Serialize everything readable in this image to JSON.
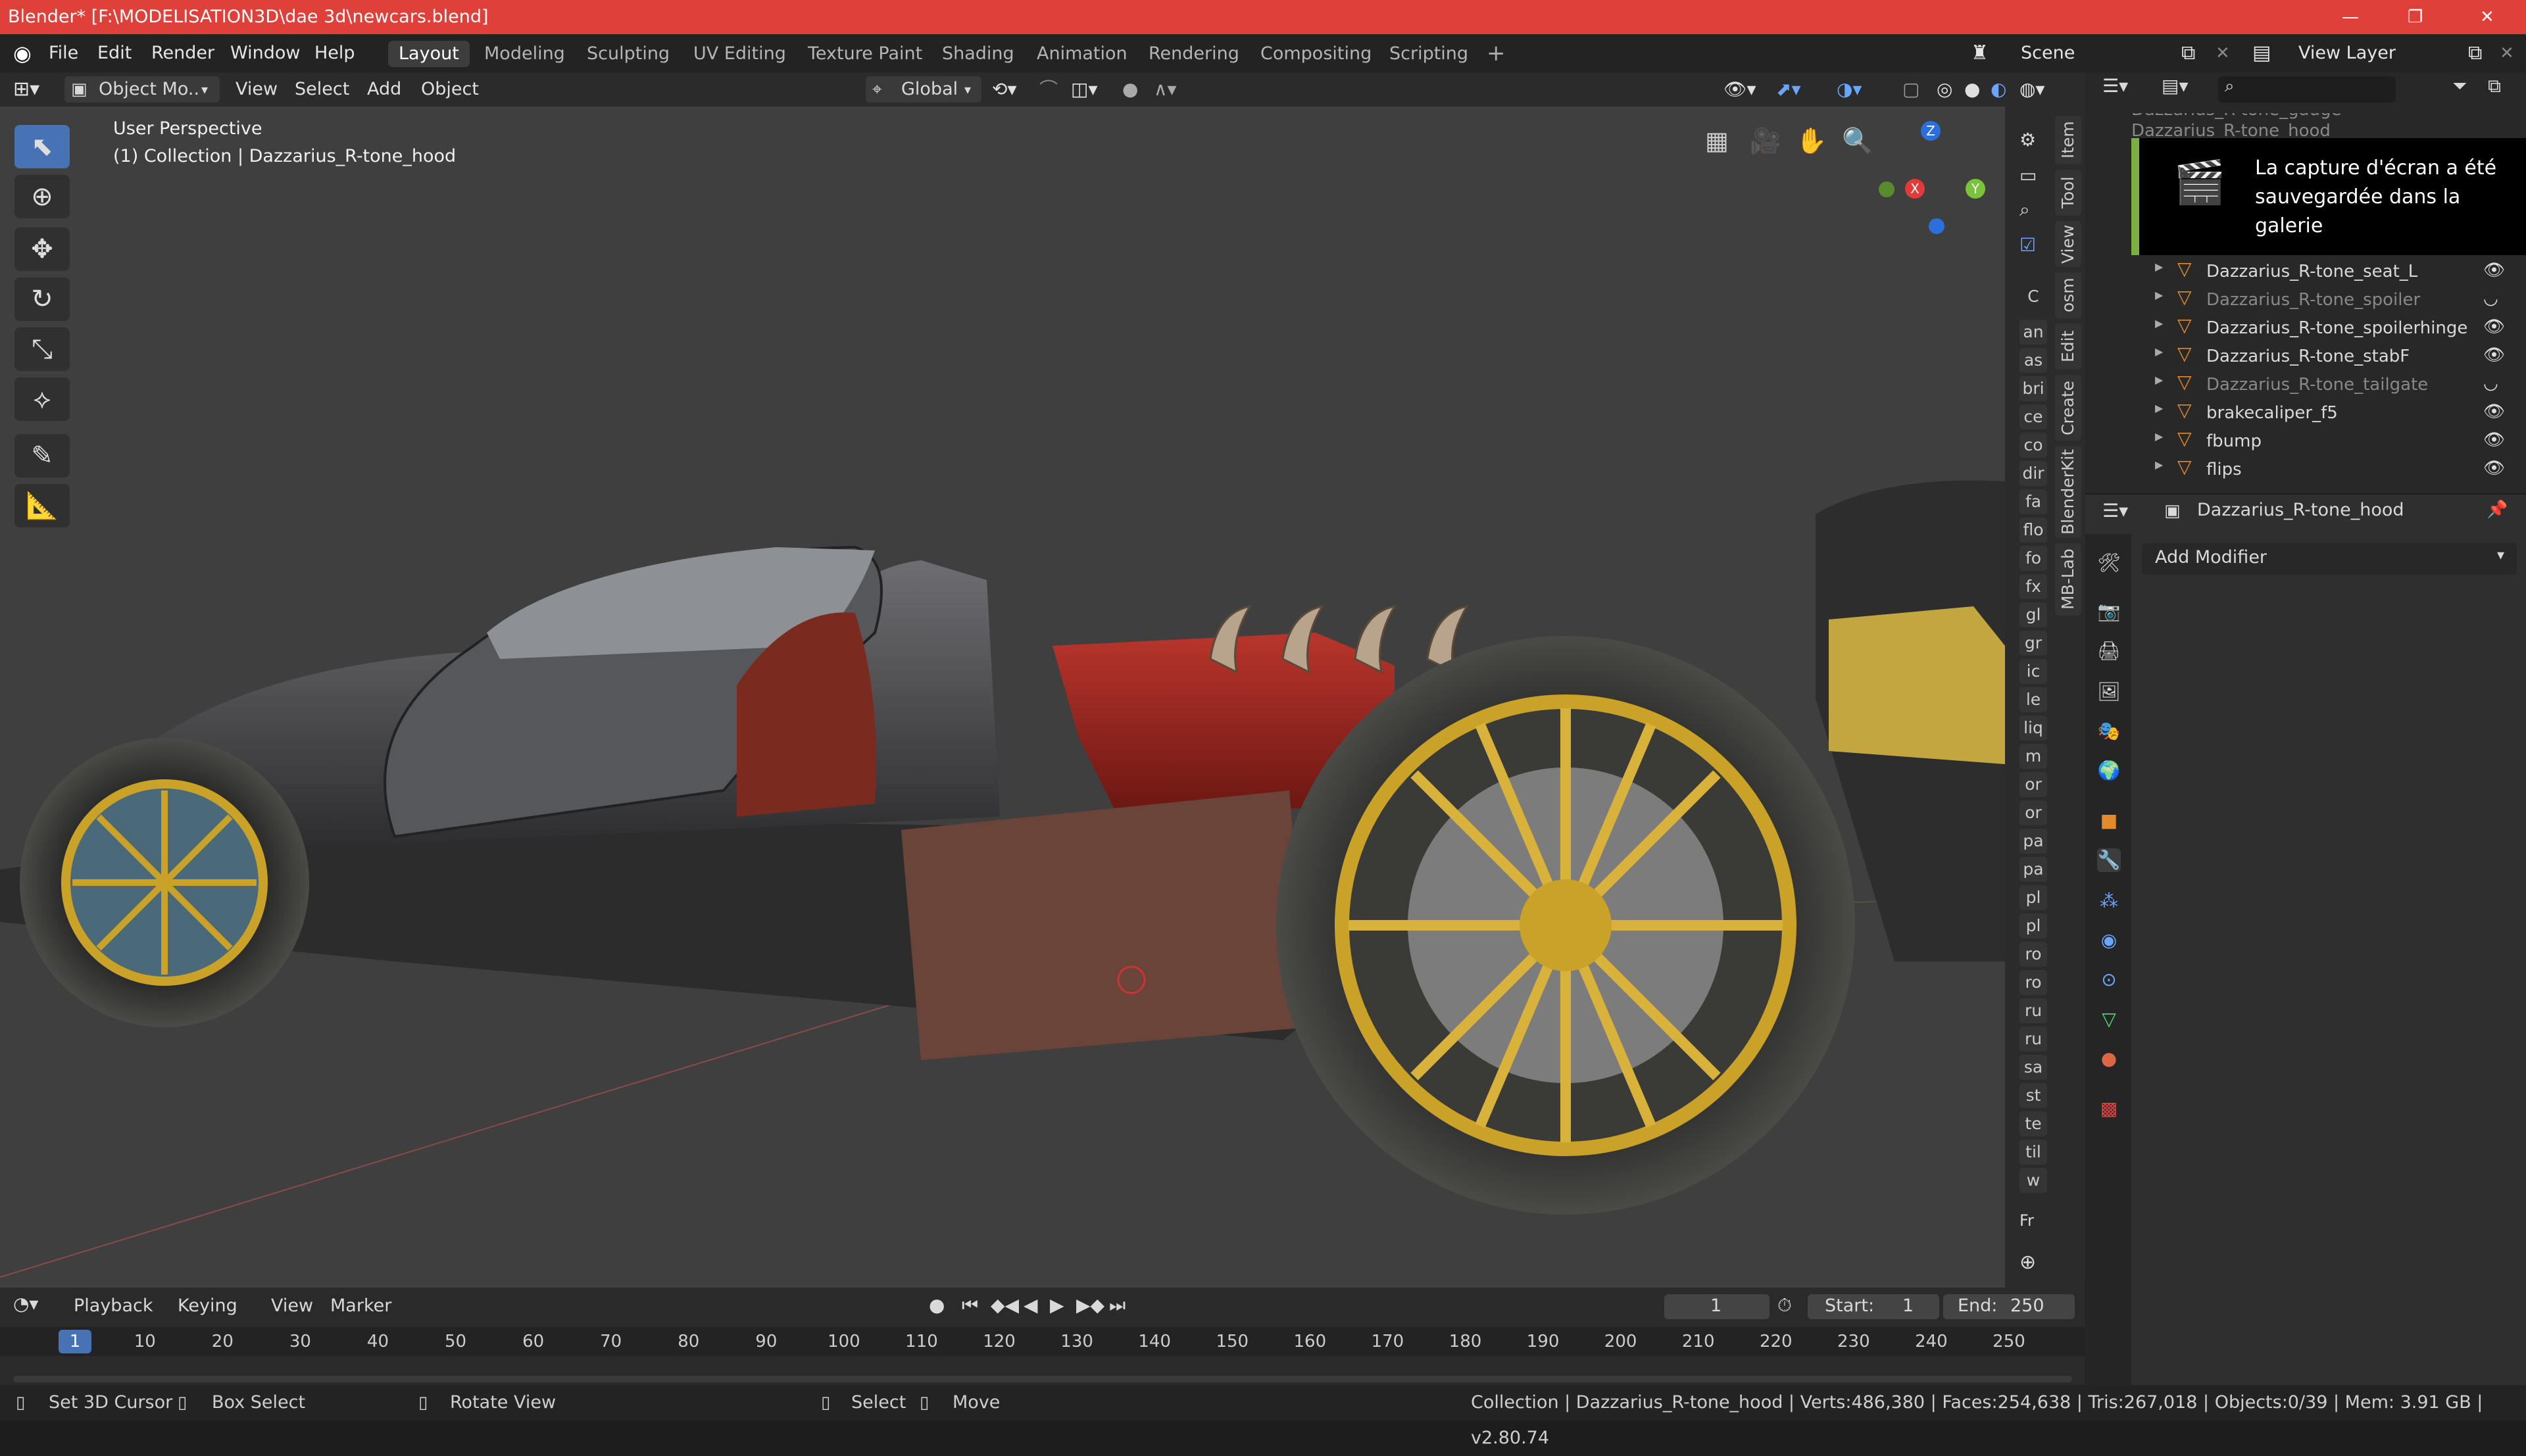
{
  "window": {
    "title": "Blender* [F:\\MODELISATION3D\\dae 3d\\newcars.blend]"
  },
  "menu": {
    "file": "File",
    "edit": "Edit",
    "render": "Render",
    "window": "Window",
    "help": "Help"
  },
  "workspaces": [
    "Layout",
    "Modeling",
    "Sculpting",
    "UV Editing",
    "Texture Paint",
    "Shading",
    "Animation",
    "Rendering",
    "Compositing",
    "Scripting"
  ],
  "scene": {
    "label": "Scene",
    "view_layer": "View Layer"
  },
  "viewport_header": {
    "mode": "Object Mo..",
    "view": "View",
    "select": "Select",
    "add": "Add",
    "object": "Object",
    "transform_orientation": "Global"
  },
  "viewport": {
    "perspective": "User Perspective",
    "collection": "(1) Collection | Dazzarius_R-tone_hood",
    "gizmo_x": "X",
    "gizmo_y": "Y",
    "gizmo_z": "Z"
  },
  "sidebar_tabs": [
    "Item",
    "Tool",
    "View",
    "osm",
    "Edit",
    "Create",
    "BlenderKit",
    "MB-Lab"
  ],
  "sidebar_chips": [
    "C",
    "an",
    "as",
    "bri",
    "ce",
    "co",
    "dir",
    "fa",
    "flo",
    "fo",
    "fx",
    "gl",
    "gr",
    "ic",
    "le",
    "liq",
    "m",
    "or",
    "or",
    "pa",
    "pa",
    "pl",
    "pl",
    "ro",
    "ro",
    "ru",
    "ru",
    "sa",
    "st",
    "te",
    "til",
    "w"
  ],
  "sidebar_bottom": "Fr",
  "notification": "La capture d'écran a été sauvegardée dans la galerie",
  "outliner": {
    "top_partial": "Dazzarius_R-tone_gauge",
    "hood_partial": "Dazzarius_R-tone_hood",
    "items": [
      {
        "name": "Dazzarius_R-tone_seat_L",
        "visible": true
      },
      {
        "name": "Dazzarius_R-tone_spoiler",
        "visible": false
      },
      {
        "name": "Dazzarius_R-tone_spoilerhinge",
        "visible": true
      },
      {
        "name": "Dazzarius_R-tone_stabF",
        "visible": true
      },
      {
        "name": "Dazzarius_R-tone_tailgate",
        "visible": false
      },
      {
        "name": "brakecaliper_f5",
        "visible": true
      },
      {
        "name": "fbump",
        "visible": true
      },
      {
        "name": "flips",
        "visible": true
      }
    ]
  },
  "properties": {
    "object_name": "Dazzarius_R-tone_hood",
    "add_modifier": "Add Modifier"
  },
  "timeline": {
    "playback": "Playback",
    "keying": "Keying",
    "view": "View",
    "marker": "Marker",
    "current_frame": "1",
    "start_label": "Start:",
    "start": "1",
    "end_label": "End:",
    "end": "250",
    "ticks": [
      "1",
      "10",
      "20",
      "30",
      "40",
      "50",
      "60",
      "70",
      "80",
      "90",
      "100",
      "110",
      "120",
      "130",
      "140",
      "150",
      "160",
      "170",
      "180",
      "190",
      "200",
      "210",
      "220",
      "230",
      "240",
      "250"
    ]
  },
  "statusbar": {
    "set_cursor": "Set 3D Cursor",
    "box_select": "Box Select",
    "rotate_view": "Rotate View",
    "select": "Select",
    "move": "Move",
    "info": "Collection | Dazzarius_R-tone_hood | Verts:486,380 | Faces:254,638 | Tris:267,018 | Objects:0/39 | Mem: 3.91 GB | v2.80.74"
  },
  "colors": {
    "title_bar": "#e0403a",
    "accent": "#4772b3",
    "notify": "#7bb040",
    "gold": "#c9a227"
  }
}
